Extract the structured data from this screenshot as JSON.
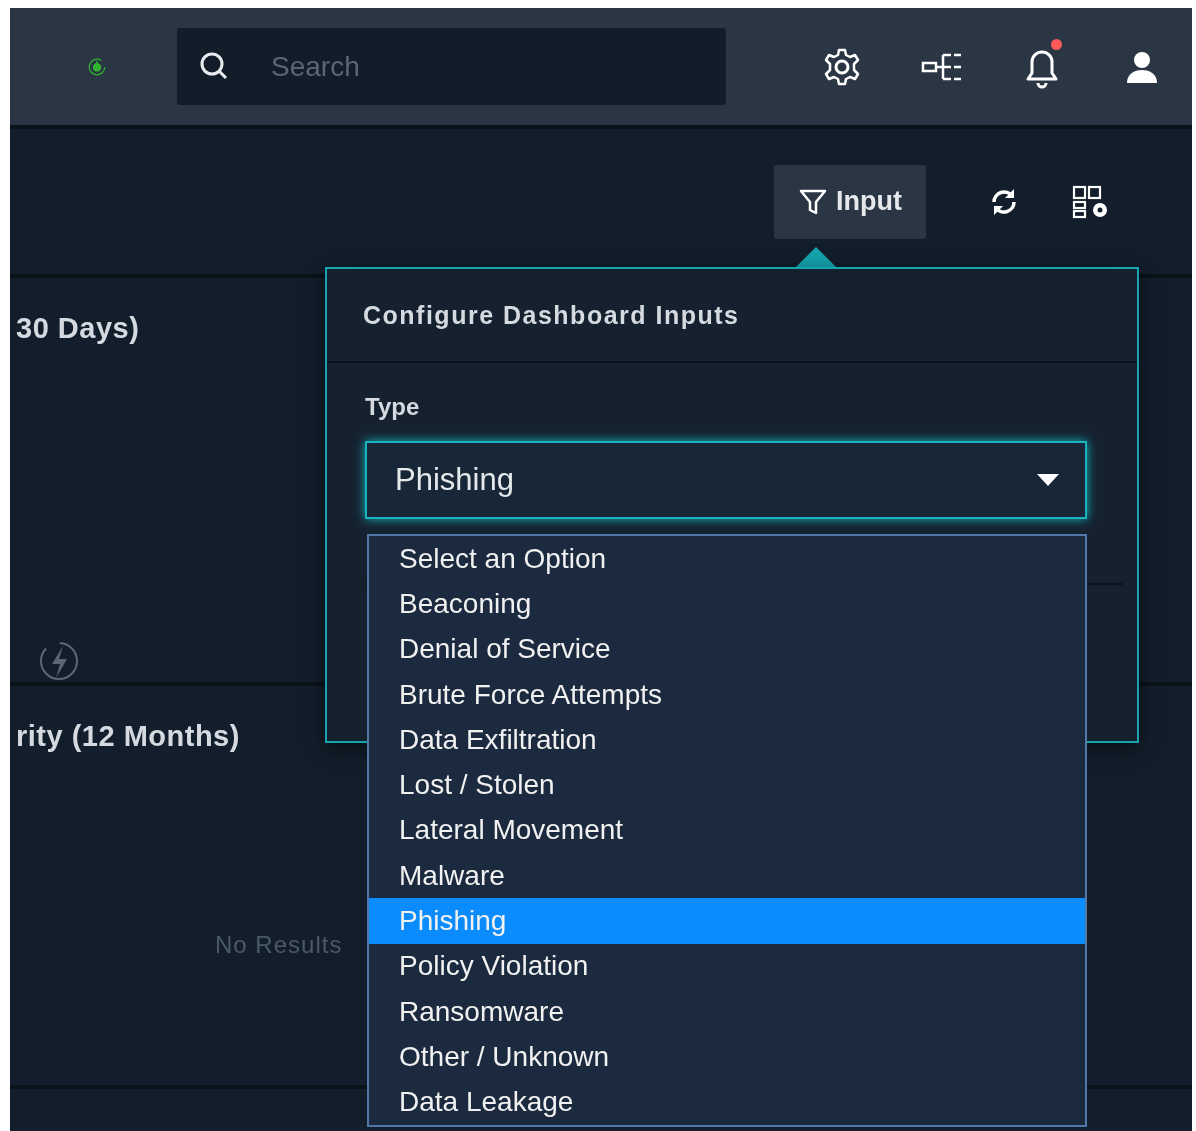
{
  "topbar": {
    "search": {
      "placeholder": "Search"
    },
    "notifications": {
      "unread": true
    }
  },
  "toolbar": {
    "input_button": "Input"
  },
  "panels": [
    {
      "title": "30 Days)"
    },
    {
      "title": "rity (12 Months)",
      "empty_text": "No Results"
    }
  ],
  "popover": {
    "title": "Configure Dashboard Inputs",
    "fields": [
      {
        "label": "Type",
        "value": "Phishing",
        "expanded": true,
        "options": [
          {
            "label": "Select an Option",
            "selected": false
          },
          {
            "label": "Beaconing",
            "selected": false
          },
          {
            "label": "Denial of Service",
            "selected": false
          },
          {
            "label": "Brute Force Attempts",
            "selected": false
          },
          {
            "label": "Data Exfiltration",
            "selected": false
          },
          {
            "label": "Lost / Stolen",
            "selected": false
          },
          {
            "label": "Lateral Movement",
            "selected": false
          },
          {
            "label": "Malware",
            "selected": false
          },
          {
            "label": "Phishing",
            "selected": true
          },
          {
            "label": "Policy Violation",
            "selected": false
          },
          {
            "label": "Ransomware",
            "selected": false
          },
          {
            "label": "Other / Unknown",
            "selected": false
          },
          {
            "label": "Data Leakage",
            "selected": false
          }
        ]
      }
    ]
  }
}
